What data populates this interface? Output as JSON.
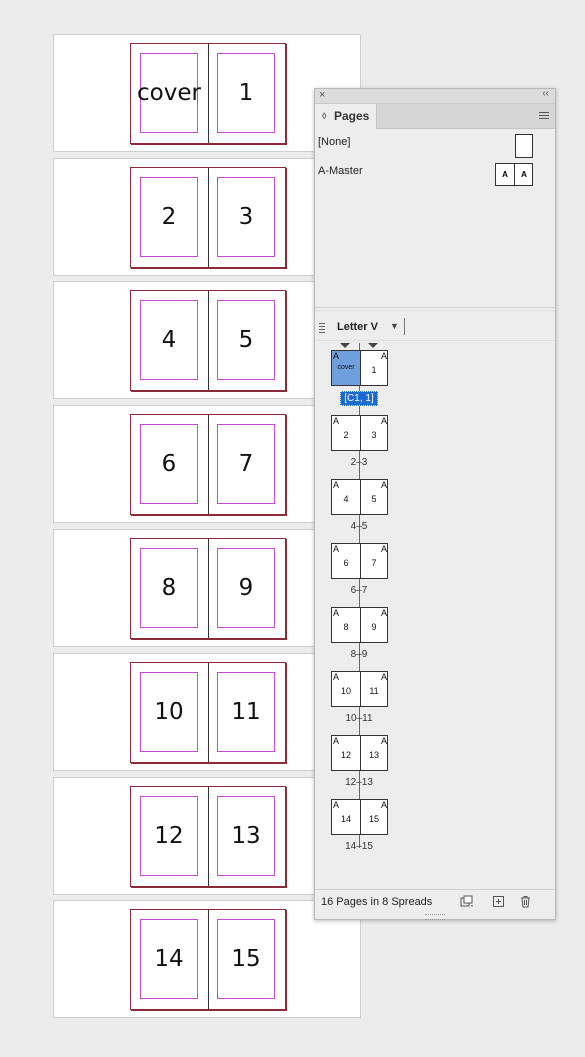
{
  "canvas": {
    "spreads": [
      {
        "left": "cover",
        "right": "1"
      },
      {
        "left": "2",
        "right": "3"
      },
      {
        "left": "4",
        "right": "5"
      },
      {
        "left": "6",
        "right": "7"
      },
      {
        "left": "8",
        "right": "9"
      },
      {
        "left": "10",
        "right": "11"
      },
      {
        "left": "12",
        "right": "13"
      },
      {
        "left": "14",
        "right": "15"
      }
    ]
  },
  "panel": {
    "close_glyph": "×",
    "collapse_glyph": "‹‹",
    "tab_label": "Pages",
    "tab_arrows": "◊",
    "masters": [
      {
        "label": "[None]"
      },
      {
        "label": "A-Master",
        "thumb_left": "A",
        "thumb_right": "A"
      }
    ],
    "page_size_label": "Letter V",
    "dropdown_glyph": "▼",
    "spreads": [
      {
        "left_master": "A",
        "right_master": "A",
        "left": "cover",
        "right": "1",
        "label": "[C1, 1]",
        "selected": true
      },
      {
        "left_master": "A",
        "right_master": "A",
        "left": "2",
        "right": "3",
        "label": "2–3"
      },
      {
        "left_master": "A",
        "right_master": "A",
        "left": "4",
        "right": "5",
        "label": "4–5"
      },
      {
        "left_master": "A",
        "right_master": "A",
        "left": "6",
        "right": "7",
        "label": "6–7"
      },
      {
        "left_master": "A",
        "right_master": "A",
        "left": "8",
        "right": "9",
        "label": "8–9"
      },
      {
        "left_master": "A",
        "right_master": "A",
        "left": "10",
        "right": "11",
        "label": "10–11"
      },
      {
        "left_master": "A",
        "right_master": "A",
        "left": "12",
        "right": "13",
        "label": "12–13"
      },
      {
        "left_master": "A",
        "right_master": "A",
        "left": "14",
        "right": "15",
        "label": "14–15"
      }
    ],
    "footer_status": "16 Pages in 8 Spreads",
    "icons": {
      "edit_size": "page-size-icon",
      "new_page": "new-page-icon",
      "delete": "trash-icon"
    },
    "colors": {
      "selection": "#1b6ad2",
      "selected_page": "#6f9fdc",
      "margin_guide": "#c34fd0",
      "bleed_frame": "#8b2a3a"
    }
  }
}
